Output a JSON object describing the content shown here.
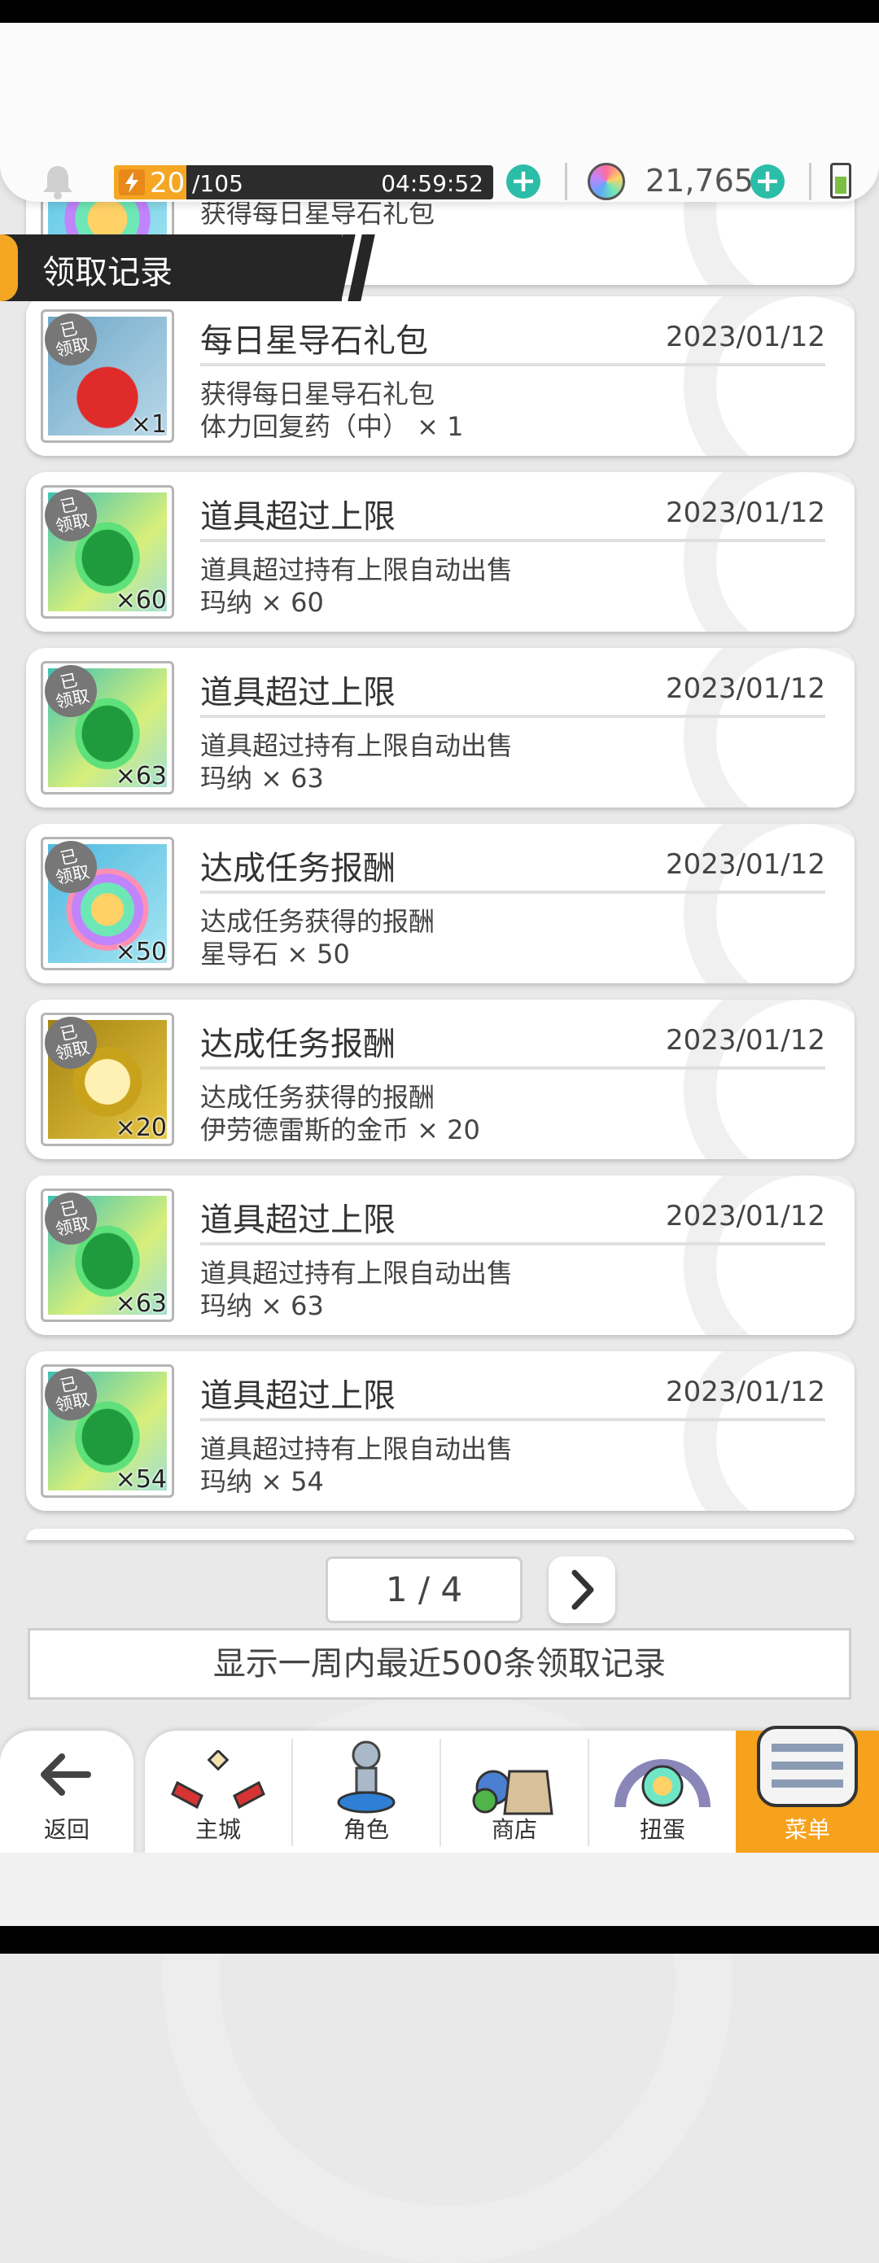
{
  "header": {
    "stamina_current": "20",
    "stamina_max": "/105",
    "stamina_timer": "04:59:52",
    "stamina_ratio": 0.19,
    "gems": "21,765"
  },
  "section_banner": "领取记录",
  "partial_top_card": {
    "desc": "获得每日星导石礼包"
  },
  "records": [
    {
      "tag": "已领取",
      "qty": "×1",
      "icon": "potion-icon",
      "title": "每日星导石礼包",
      "date": "2023/01/12",
      "line1": "获得每日星导石礼包",
      "line2": "体力回复药（中） × 1"
    },
    {
      "tag": "已领取",
      "qty": "×60",
      "icon": "green-gem-icon",
      "title": "道具超过上限",
      "date": "2023/01/12",
      "line1": "道具超过持有上限自动出售",
      "line2": "玛纳 × 60"
    },
    {
      "tag": "已领取",
      "qty": "×63",
      "icon": "green-gem-icon",
      "title": "道具超过上限",
      "date": "2023/01/12",
      "line1": "道具超过持有上限自动出售",
      "line2": "玛纳 × 63"
    },
    {
      "tag": "已领取",
      "qty": "×50",
      "icon": "star-stone-icon",
      "title": "达成任务报酬",
      "date": "2023/01/12",
      "line1": "达成任务获得的报酬",
      "line2": "星导石 × 50"
    },
    {
      "tag": "已领取",
      "qty": "×20",
      "icon": "gold-coin-icon",
      "title": "达成任务报酬",
      "date": "2023/01/12",
      "line1": "达成任务获得的报酬",
      "line2": "伊劳德雷斯的金币 × 20"
    },
    {
      "tag": "已领取",
      "qty": "×63",
      "icon": "green-gem-icon",
      "title": "道具超过上限",
      "date": "2023/01/12",
      "line1": "道具超过持有上限自动出售",
      "line2": "玛纳 × 63"
    },
    {
      "tag": "已领取",
      "qty": "×54",
      "icon": "green-gem-icon",
      "title": "道具超过上限",
      "date": "2023/01/12",
      "line1": "道具超过持有上限自动出售",
      "line2": "玛纳 × 54"
    }
  ],
  "pagination": {
    "text": "1 / 4"
  },
  "notice": "显示一周内最近500条领取记录",
  "nav": {
    "back": "返回",
    "items": [
      "主城",
      "角色",
      "商店",
      "扭蛋",
      "菜单"
    ],
    "active_index": 4
  },
  "colors": {
    "accent": "#f6a21d",
    "stamina": "#f5a623",
    "plus": "#2bbda8"
  }
}
